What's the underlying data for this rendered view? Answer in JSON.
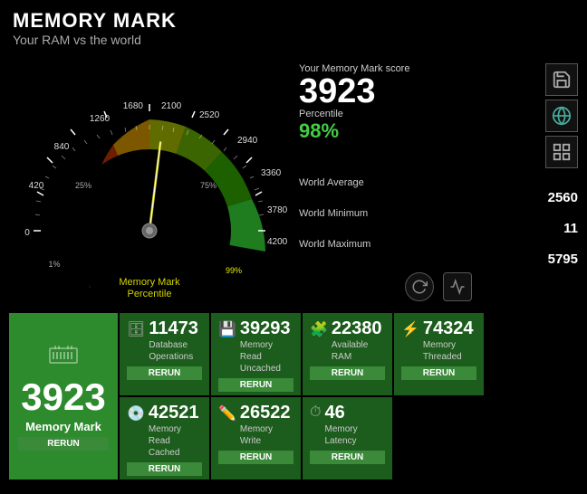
{
  "header": {
    "title": "MEMORY MARK",
    "subtitle": "Your RAM vs the world"
  },
  "gauge": {
    "ticks": [
      "0",
      "420",
      "840",
      "1260",
      "1680",
      "2100",
      "2520",
      "2940",
      "3360",
      "3780",
      "4200"
    ],
    "percentile_markers": [
      "1%",
      "25%",
      "75%",
      "99%"
    ],
    "labels": [
      "Memory Mark",
      "Percentile"
    ]
  },
  "score_panel": {
    "score_label": "Your Memory Mark score",
    "score": "3923",
    "percentile_label": "Percentile",
    "percentile": "98%",
    "world_average_label": "World Average",
    "world_average": "2560",
    "world_minimum_label": "World Minimum",
    "world_minimum": "11",
    "world_maximum_label": "World Maximum",
    "world_maximum": "5795"
  },
  "results": [
    {
      "id": "memory-mark",
      "score": "3923",
      "label": "Memory Mark",
      "rerun": "RERUN",
      "main": true
    },
    {
      "id": "database-ops",
      "score": "11473",
      "label": "Database\nOperations",
      "rerun": "RERUN"
    },
    {
      "id": "memory-read-uncached",
      "score": "39293",
      "label": "Memory Read\nUncached",
      "rerun": "RERUN"
    },
    {
      "id": "available-ram",
      "score": "22380",
      "label": "Available RAM",
      "rerun": "RERUN"
    },
    {
      "id": "memory-threaded",
      "score": "74324",
      "label": "Memory Threaded",
      "rerun": "RERUN"
    },
    {
      "id": "memory-read-cached",
      "score": "42521",
      "label": "Memory Read\nCached",
      "rerun": "RERUN"
    },
    {
      "id": "memory-write",
      "score": "26522",
      "label": "Memory Write",
      "rerun": "RERUN"
    },
    {
      "id": "memory-latency",
      "score": "46",
      "label": "Memory Latency",
      "rerun": "RERUN"
    }
  ]
}
